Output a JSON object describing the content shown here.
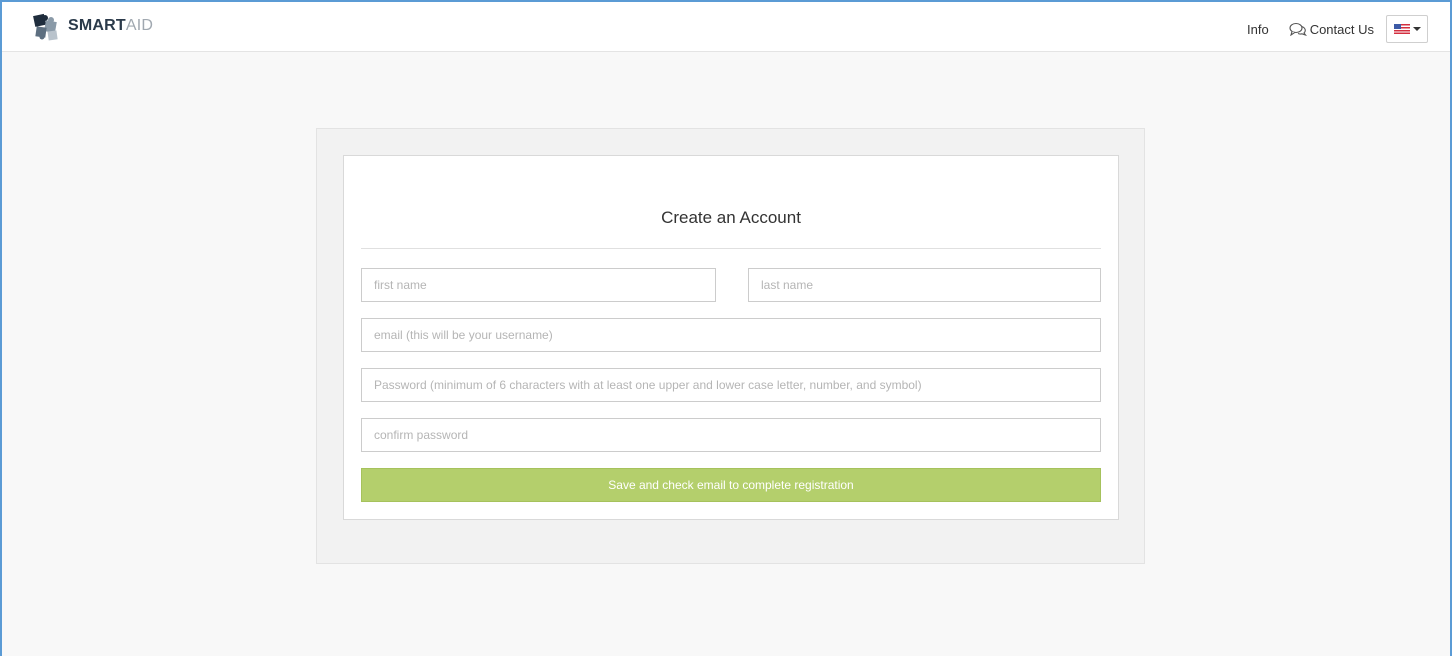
{
  "brand": {
    "strong": "SMART",
    "light": "AID",
    "logo_icon": "puzzle-icon"
  },
  "nav": {
    "info_label": "Info",
    "contact_label": "Contact Us",
    "contact_icon": "chat-bubbles-icon",
    "language_icon": "us-flag-icon"
  },
  "form": {
    "title": "Create an Account",
    "first_name_placeholder": "first name",
    "last_name_placeholder": "last name",
    "email_placeholder": "email (this will be your username)",
    "password_placeholder": "Password (minimum of 6 characters with at least one upper and lower case letter, number, and symbol)",
    "confirm_placeholder": "confirm password",
    "submit_label": "Save and check email to complete registration"
  },
  "colors": {
    "accent_green": "#b4cf6c",
    "frame_blue": "#5b9bd5",
    "page_bg": "#f8f8f8"
  }
}
